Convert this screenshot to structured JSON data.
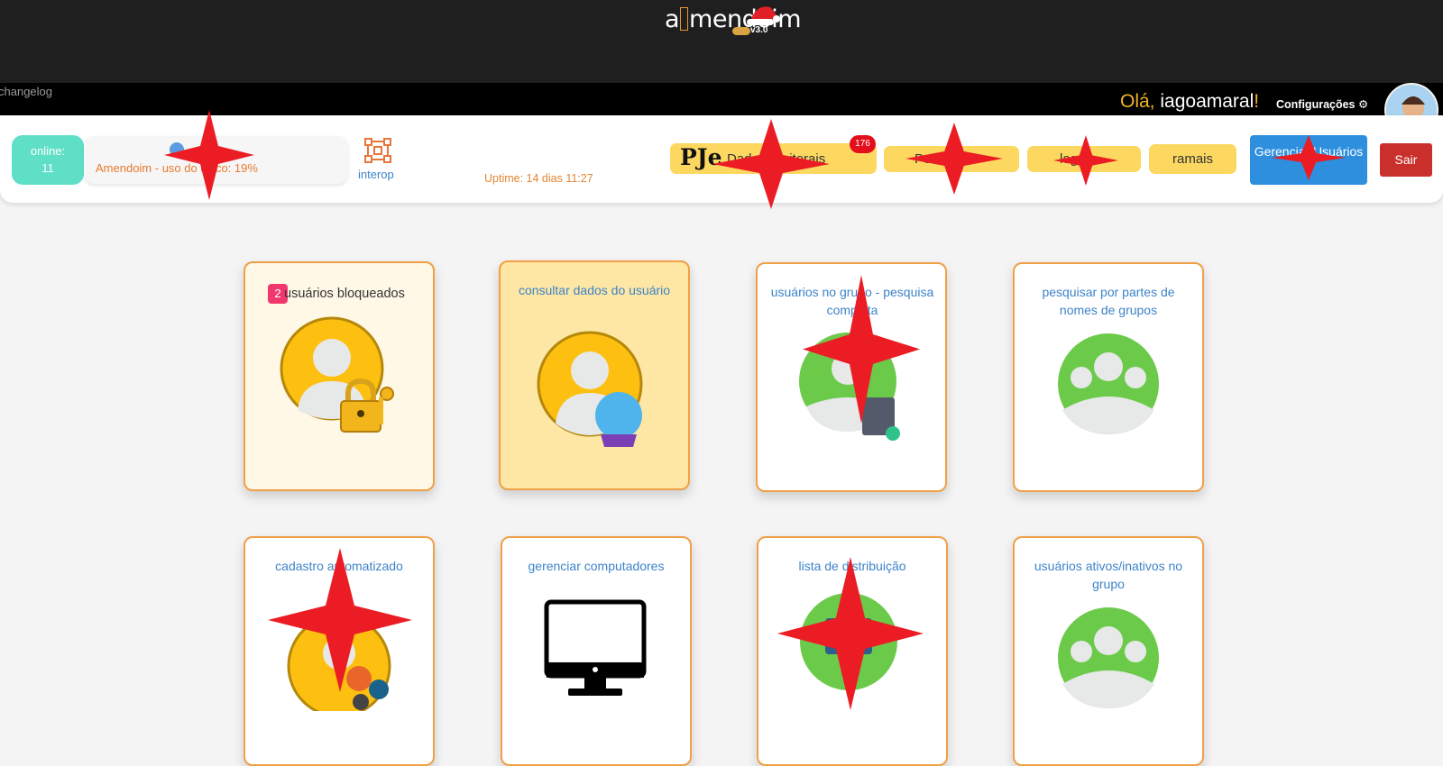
{
  "header": {
    "logo_text_a": "a",
    "logo_text_rest": "mendoim",
    "version": "v3.0",
    "changelog": "changelog",
    "greeting_prefix": "Olá,",
    "username": "iagoamaral",
    "greeting_suffix": "!",
    "settings_label": "Configurações"
  },
  "toolbar": {
    "online_label": "online:",
    "online_count": "11",
    "usage_text": "Amendoim - uso do disco: 19%",
    "interop_label": "interop",
    "uptime": "Uptime: 14 dias 11:27",
    "pje_logo": "PJe",
    "pje_label": "Dados Eleitorais",
    "pje_badge": "176",
    "btn2_label": "Portal",
    "btn3_label": "log",
    "ramais_label": "ramais",
    "manage_label": "Gerenciar Usuários",
    "logout_label": "Sair"
  },
  "cards": [
    {
      "title": "usuários bloqueados",
      "badge": "2"
    },
    {
      "title": "consultar dados do usuário"
    },
    {
      "title": "usuários no grupo - pesquisa completa"
    },
    {
      "title": "pesquisar por partes de nomes de grupos"
    },
    {
      "title": "cadastro automatizado"
    },
    {
      "title": "gerenciar computadores"
    },
    {
      "title": "lista de distribuição"
    },
    {
      "title": "usuários ativos/inativos no grupo"
    }
  ],
  "colors": {
    "accent_orange": "#f0a046",
    "link_blue": "#3d83c9",
    "primary_blue": "#2d8fde",
    "danger_red": "#c9302c",
    "online_teal": "#5fe0c6",
    "button_yellow": "#fcd860"
  }
}
